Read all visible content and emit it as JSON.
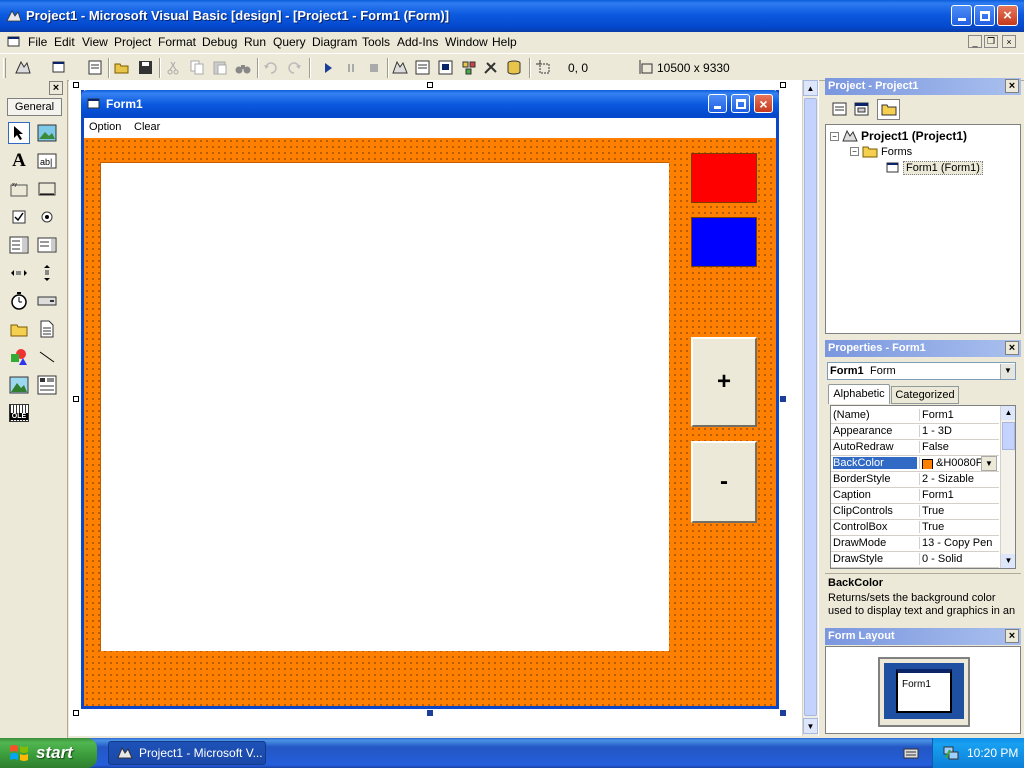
{
  "window": {
    "title": "Project1 - Microsoft Visual Basic [design] - [Project1 - Form1 (Form)]"
  },
  "menubar": {
    "items": [
      "File",
      "Edit",
      "View",
      "Project",
      "Format",
      "Debug",
      "Run",
      "Query",
      "Diagram",
      "Tools",
      "Add-Ins",
      "Window",
      "Help"
    ]
  },
  "toolbar": {
    "position_readout": "0, 0",
    "size_readout": "10500 x 9330"
  },
  "toolbox": {
    "tab_label": "General",
    "tools": [
      "pointer-icon",
      "picturebox-icon",
      "label-icon",
      "textbox-icon",
      "frame-icon",
      "commandbutton-icon",
      "checkbox-icon",
      "optionbutton-icon",
      "combobox-icon",
      "listbox-icon",
      "hscrollbar-icon",
      "vscrollbar-icon",
      "timer-icon",
      "drivelistbox-icon",
      "dirlistbox-icon",
      "filelistbox-icon",
      "shape-icon",
      "line-icon",
      "image-icon",
      "data-icon",
      "ole-icon"
    ],
    "ole_label": "OLE"
  },
  "form": {
    "title": "Form1",
    "menu": [
      "Option",
      "Clear"
    ],
    "backcolor": "#FF8000",
    "swatch_colors": [
      "#FF0000",
      "#0000FF"
    ],
    "plus_label": "+",
    "minus_label": "-"
  },
  "project_explorer": {
    "title": "Project - Project1",
    "root": "Project1 (Project1)",
    "folder": "Forms",
    "form_item": "Form1 (Form1)"
  },
  "properties": {
    "title": "Properties - Form1",
    "object_name": "Form1",
    "object_type": "Form",
    "tabs": [
      "Alphabetic",
      "Categorized"
    ],
    "rows": [
      {
        "name": "(Name)",
        "value": "Form1"
      },
      {
        "name": "Appearance",
        "value": "1 - 3D"
      },
      {
        "name": "AutoRedraw",
        "value": "False"
      },
      {
        "name": "BackColor",
        "value": "&H0080FF&",
        "selected": true
      },
      {
        "name": "BorderStyle",
        "value": "2 - Sizable"
      },
      {
        "name": "Caption",
        "value": "Form1"
      },
      {
        "name": "ClipControls",
        "value": "True"
      },
      {
        "name": "ControlBox",
        "value": "True"
      },
      {
        "name": "DrawMode",
        "value": "13 - Copy Pen"
      },
      {
        "name": "DrawStyle",
        "value": "0 - Solid"
      }
    ],
    "description_title": "BackColor",
    "description_text": "Returns/sets the background color used to display text and graphics in an"
  },
  "form_layout": {
    "title": "Form Layout",
    "preview_label": "Form1"
  },
  "taskbar": {
    "start_label": "start",
    "task_label": "Project1 - Microsoft V...",
    "clock": "10:20 PM"
  }
}
